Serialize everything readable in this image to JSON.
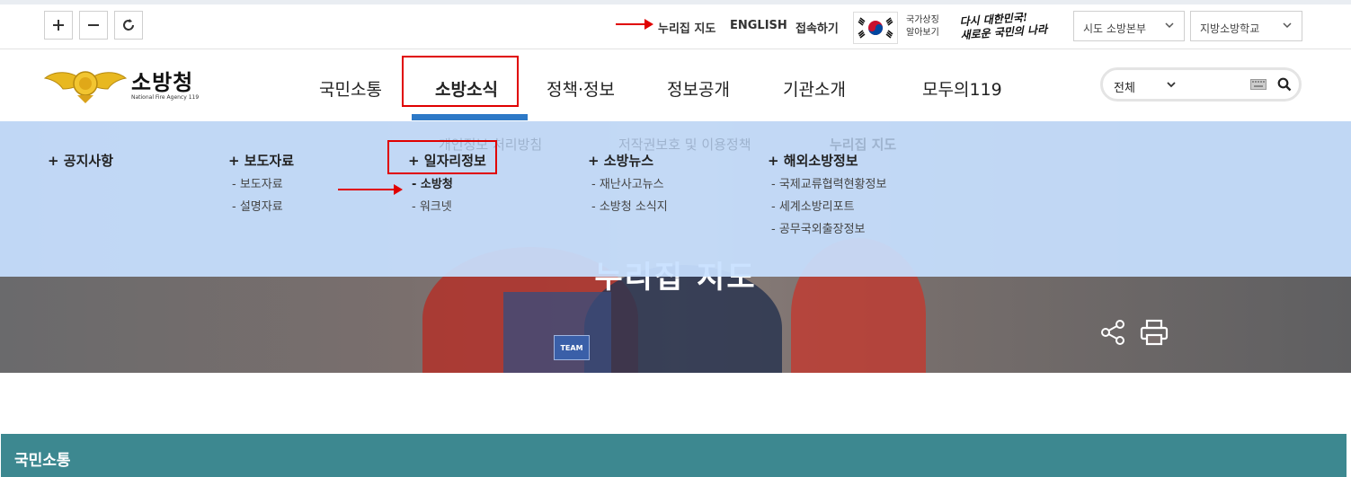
{
  "utility": {
    "zoom_in_label": "+",
    "zoom_out_label": "–",
    "links": [
      "누리집 지도",
      "ENGLISH",
      "접속하기"
    ],
    "symbol_text": [
      "국가상징",
      "알아보기"
    ],
    "slogan": [
      "다시 대한민국!",
      "새로운 국민의 나라"
    ],
    "selects": [
      "시도 소방본부",
      "지방소방학교"
    ]
  },
  "logo": {
    "name": "소방청",
    "english": "National Fire Agency 119"
  },
  "nav": {
    "items": [
      "국민소통",
      "소방소식",
      "정책·정보",
      "정보공개",
      "기관소개",
      "모두의119"
    ],
    "active": "소방소식"
  },
  "search": {
    "scope": "전체"
  },
  "dropdown": {
    "ghost_links": [
      "개인정보 처리방침",
      "저작권보호 및 이용정책",
      "누리집 지도"
    ],
    "columns": [
      {
        "title": "+ 공지사항",
        "items": []
      },
      {
        "title": "+ 보도자료",
        "items": [
          "- 보도자료",
          "- 설명자료"
        ]
      },
      {
        "title": "+ 일자리정보",
        "items": [
          "- 소방청",
          "- 워크넷"
        ]
      },
      {
        "title": "+ 소방뉴스",
        "items": [
          "- 재난사고뉴스",
          "- 소방청 소식지"
        ]
      },
      {
        "title": "+ 해외소방정보",
        "items": [
          "- 국제교류협력현황정보",
          "- 세계소방리포트",
          "- 공무국외출장정보"
        ]
      }
    ]
  },
  "hero": {
    "title": "누리집 지도",
    "badge": "TEAM"
  },
  "section": {
    "title": "국민소통"
  },
  "colors": {
    "accent_blue": "#2d79c7",
    "highlight_red": "#e00000",
    "section_teal": "#3d8890",
    "dropdown_bg": "#c7e0ff"
  },
  "icons": [
    "plus-icon",
    "minus-icon",
    "refresh-icon",
    "chevron-down-icon",
    "keyboard-icon",
    "search-icon",
    "share-icon",
    "print-icon"
  ]
}
